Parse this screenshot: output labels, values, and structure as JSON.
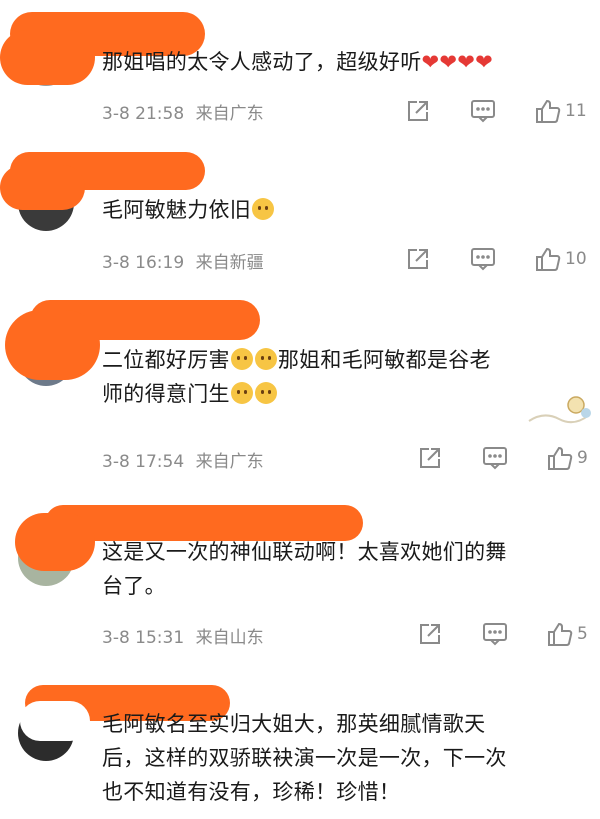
{
  "comments": [
    {
      "text": "那姐唱的太令人感动了，超级好听",
      "hearts": "❤❤❤❤",
      "time": "3-8 21:58",
      "location": "来自广东",
      "likes": "11"
    },
    {
      "text": "毛阿敏魅力依旧",
      "time": "3-8 16:19",
      "location": "来自新疆",
      "likes": "10"
    },
    {
      "line1_a": "二位都好厉害",
      "line1_b": "那姐和毛阿敏都是谷老",
      "line2": "师的得意门生",
      "time": "3-8 17:54",
      "location": "来自广东",
      "likes": "9"
    },
    {
      "line1": "这是又一次的神仙联动啊！太喜欢她们的舞",
      "line2": "台了。",
      "time": "3-8 15:31",
      "location": "来自山东",
      "likes": "5"
    },
    {
      "line1": "毛阿敏名至实归大姐大，那英细腻情歌天",
      "line2": "后，这样的双骄联袂演一次是一次，下一次",
      "line3": "也不知道有没有，珍稀！珍惜！"
    }
  ],
  "icons": {
    "share": "share-icon",
    "comment": "comment-icon",
    "like": "thumbs-up-icon"
  },
  "colors": {
    "redaction": "#ff6a1f",
    "meta_text": "#8a8a8a",
    "heart": "#e53935"
  }
}
